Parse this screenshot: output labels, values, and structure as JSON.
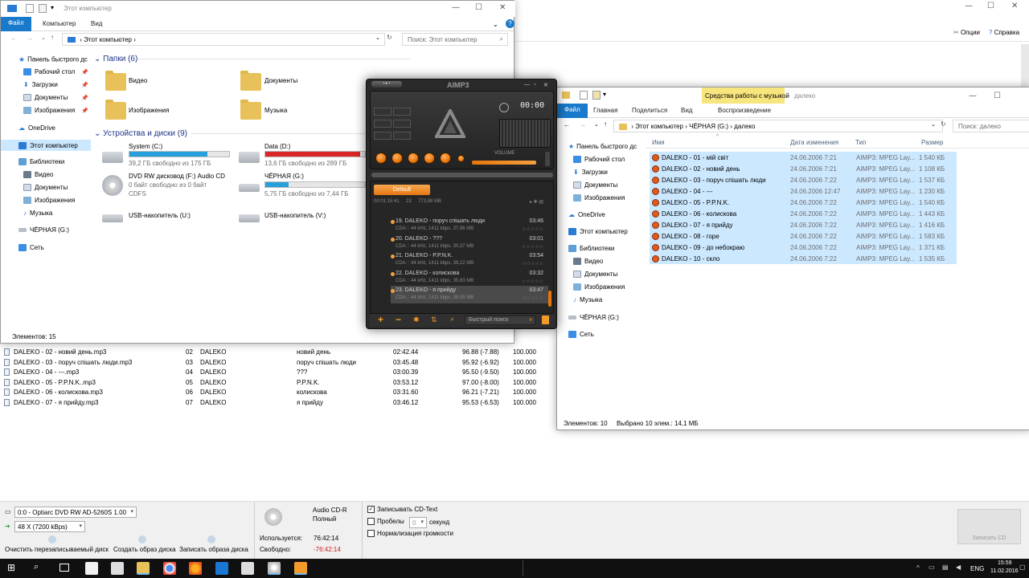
{
  "explorer1": {
    "tabs": [
      "Файл",
      "Компьютер",
      "Вид"
    ],
    "title": "Этот компьютер",
    "address": "Этот компьютер",
    "search_placeholder": "Поиск: Этот компьютер",
    "nav": [
      "Панель быстрого дс",
      "Рабочий стол",
      "Загрузки",
      "Документы",
      "Изображения",
      "OneDrive",
      "Этот компьютер",
      "Библиотеки",
      "Видео",
      "Документы",
      "Изображения",
      "Музыка",
      "ЧЁРНАЯ (G:)",
      "Сеть"
    ],
    "folders_header": "Папки (6)",
    "folders": [
      "Видео",
      "Документы",
      "Изображения",
      "Музыка"
    ],
    "devices_header": "Устройства и диски (9)",
    "drives": [
      {
        "name": "System (C:)",
        "free": "39,2 ГБ свободно из 175 ГБ",
        "fill": 0.78,
        "color": "#26a0da"
      },
      {
        "name": "Data (D:)",
        "free": "13,6 ГБ свободно из 289 ГБ",
        "fill": 0.95,
        "color": "#da2626"
      },
      {
        "name": "DVD RW дисковод (F:) Audio CD",
        "free": "0 байт свободно из 0 байт",
        "fs": "CDFS"
      },
      {
        "name": "ЧЁРНАЯ (G:)",
        "free": "5,75 ГБ свободно из 7,44 ГБ",
        "fill": 0.23,
        "color": "#26a0da"
      },
      {
        "name": "USB-накопитель (U:)"
      },
      {
        "name": "USB-накопитель (V:)"
      }
    ],
    "status": "Элементов: 15"
  },
  "explorer2": {
    "tabs": [
      "Файл",
      "Главная",
      "Поделиться",
      "Вид",
      "Воспроизведение"
    ],
    "context_tab": "Средства работы с музыкой",
    "title": "далеко",
    "breadcrumb": [
      "Этот компьютер",
      "ЧЁРНАЯ (G:)",
      "далеко"
    ],
    "search_placeholder": "Поиск: далеко",
    "nav": [
      "Панель быстрого дс",
      "Рабочий стол",
      "Загрузки",
      "Документы",
      "Изображения",
      "OneDrive",
      "Этот компьютер",
      "Библиотеки",
      "Видео",
      "Документы",
      "Изображения",
      "Музыка",
      "ЧЁРНАЯ (G:)",
      "Сеть"
    ],
    "columns": [
      "Имя",
      "Дата изменения",
      "Тип",
      "Размер"
    ],
    "rows": [
      [
        "DALEKO - 01 - мій світ",
        "24.06.2006 7:21",
        "AIMP3: MPEG Lay...",
        "1 540 КБ"
      ],
      [
        "DALEKO - 02 - новий день",
        "24.06.2006 7:21",
        "AIMP3: MPEG Lay...",
        "1 108 КБ"
      ],
      [
        "DALEKO - 03 - поруч спішать люди",
        "24.06.2006 7:22",
        "AIMP3: MPEG Lay...",
        "1 537 КБ"
      ],
      [
        "DALEKO - 04 - ---",
        "24.06.2006 12:47",
        "AIMP3: MPEG Lay...",
        "1 230 КБ"
      ],
      [
        "DALEKO - 05 - P.P.N.K.",
        "24.06.2006 7:22",
        "AIMP3: MPEG Lay...",
        "1 540 КБ"
      ],
      [
        "DALEKO - 06 - колискова",
        "24.06.2006 7:22",
        "AIMP3: MPEG Lay...",
        "1 443 КБ"
      ],
      [
        "DALEKO - 07 - я прийду",
        "24.06.2006 7:22",
        "AIMP3: MPEG Lay...",
        "1 416 КБ"
      ],
      [
        "DALEKO - 08 - горе",
        "24.06.2006 7:22",
        "AIMP3: MPEG Lay...",
        "1 583 КБ"
      ],
      [
        "DALEKO - 09 - до небокраю",
        "24.06.2006 7:22",
        "AIMP3: MPEG Lay...",
        "1 371 КБ"
      ],
      [
        "DALEKO - 10 - скло",
        "24.06.2006 7:22",
        "AIMP3: MPEG Lay...",
        "1 535 КБ"
      ]
    ],
    "status_count": "Элементов: 10",
    "status_selected": "Выбрано 10 элем.: 14,1 МБ"
  },
  "aimp": {
    "logo": "AIMP3",
    "time": "00:00",
    "volume_label": "VOLUME",
    "playlist_tab": "Default",
    "summary": "00:01:15:41     23     773,88 MB",
    "tracks": [
      {
        "title": "19. DALEKO - поруч спішать люди",
        "dur": "03:46",
        "meta": "CDA :: 44 kHz, 1411 kbps, 37,96 MB"
      },
      {
        "title": "20. DALEKO - ???",
        "dur": "03:01",
        "meta": "CDA :: 44 kHz, 1411 kbps, 30,37 MB"
      },
      {
        "title": "21. DALEKO - P.P.N.K.",
        "dur": "03:54",
        "meta": "CDA :: 44 kHz, 1411 kbps, 39,22 MB"
      },
      {
        "title": "22. DALEKO - колискова",
        "dur": "03:32",
        "meta": "CDA :: 44 kHz, 1411 kbps, 35,63 MB"
      },
      {
        "title": "23. DALEKO - я прийду",
        "dur": "03:47",
        "meta": "CDA :: 44 kHz, 1411 kbps, 38,05 MB"
      }
    ],
    "search_placeholder": "Быстрый поиск"
  },
  "burner": {
    "right_links": [
      "Опции",
      "Справка"
    ],
    "rows": [
      [
        "DALEKO - 02 - новий день.mp3",
        "02",
        "DALEKO",
        "новий день",
        "02:42.44",
        "96.88 (-7.88)",
        "100.000"
      ],
      [
        "DALEKO - 03 - поруч спішать люди.mp3",
        "03",
        "DALEKO",
        "поруч спішать люди",
        "03:45.48",
        "95.92 (-6.92)",
        "100.000"
      ],
      [
        "DALEKO - 04 - ---.mp3",
        "04",
        "DALEKO",
        "???",
        "03:00.39",
        "95.50 (-9.50)",
        "100.000"
      ],
      [
        "DALEKO - 05 - P.P.N.K..mp3",
        "05",
        "DALEKO",
        "P.P.N.K.",
        "03:53.12",
        "97.00 (-8.00)",
        "100.000"
      ],
      [
        "DALEKO - 06 - колискова.mp3",
        "06",
        "DALEKO",
        "колискова",
        "03:31.60",
        "96.21 (-7.21)",
        "100.000"
      ],
      [
        "DALEKO - 07 - я прийду.mp3",
        "07",
        "DALEKO",
        "я прийду",
        "03:46.12",
        "95.53 (-6.53)",
        "100.000"
      ]
    ],
    "drive_select": "0:0 - Optiarc DVD RW AD-5260S 1.00",
    "speed_select": "48 X (7200 kBps)",
    "actions": [
      "Очистить перезаписываемый диск",
      "Создать образ диска",
      "Записать образа диска"
    ],
    "disc_type": "Audio CD-R",
    "disc_state": "Полный",
    "used_label": "Используется:",
    "used_value": "76:42:14",
    "free_label": "Свободно:",
    "free_value": "-76:42:14",
    "opt_cdtext": "Записывать CD-Text",
    "opt_gaps": "Пробелы",
    "gap_value": "0",
    "gap_unit": "секунд",
    "opt_normalize": "Нормализация громкости",
    "burn_button": "Записать CD"
  },
  "taskbar": {
    "lang": "ENG",
    "time": "15:59",
    "date": "11.02.2016"
  }
}
